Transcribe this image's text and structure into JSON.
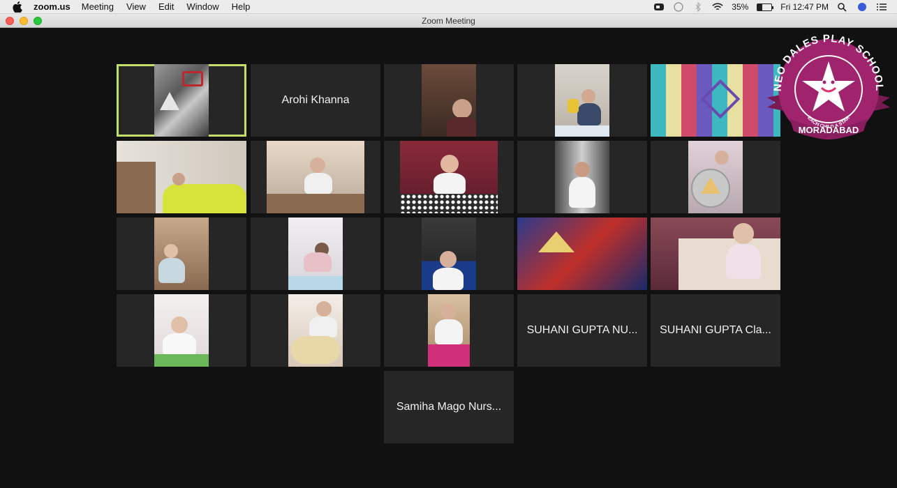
{
  "menubar": {
    "app_name": "zoom.us",
    "items": [
      "Meeting",
      "View",
      "Edit",
      "Window",
      "Help"
    ],
    "battery_percent": "35%",
    "clock": "Fri 12:47 PM",
    "battery_level": 0.35
  },
  "window": {
    "title": "Zoom Meeting"
  },
  "participants": [
    {
      "label": "Arohi Khanna"
    },
    {
      "label": "SUHANI GUPTA NU..."
    },
    {
      "label": "SUHANI GUPTA Cla..."
    },
    {
      "label": "Samiha Mago Nurs..."
    }
  ],
  "logo": {
    "top_text": "NEO DALES PLAY SCHOOL",
    "motto": "EACH CHILD A STAR",
    "city": "MORADABAD",
    "color": "#a0236e"
  },
  "colors": {
    "active_speaker_border": "#c3e06b",
    "tile_bg": "#262626",
    "stage_bg": "#111111"
  }
}
